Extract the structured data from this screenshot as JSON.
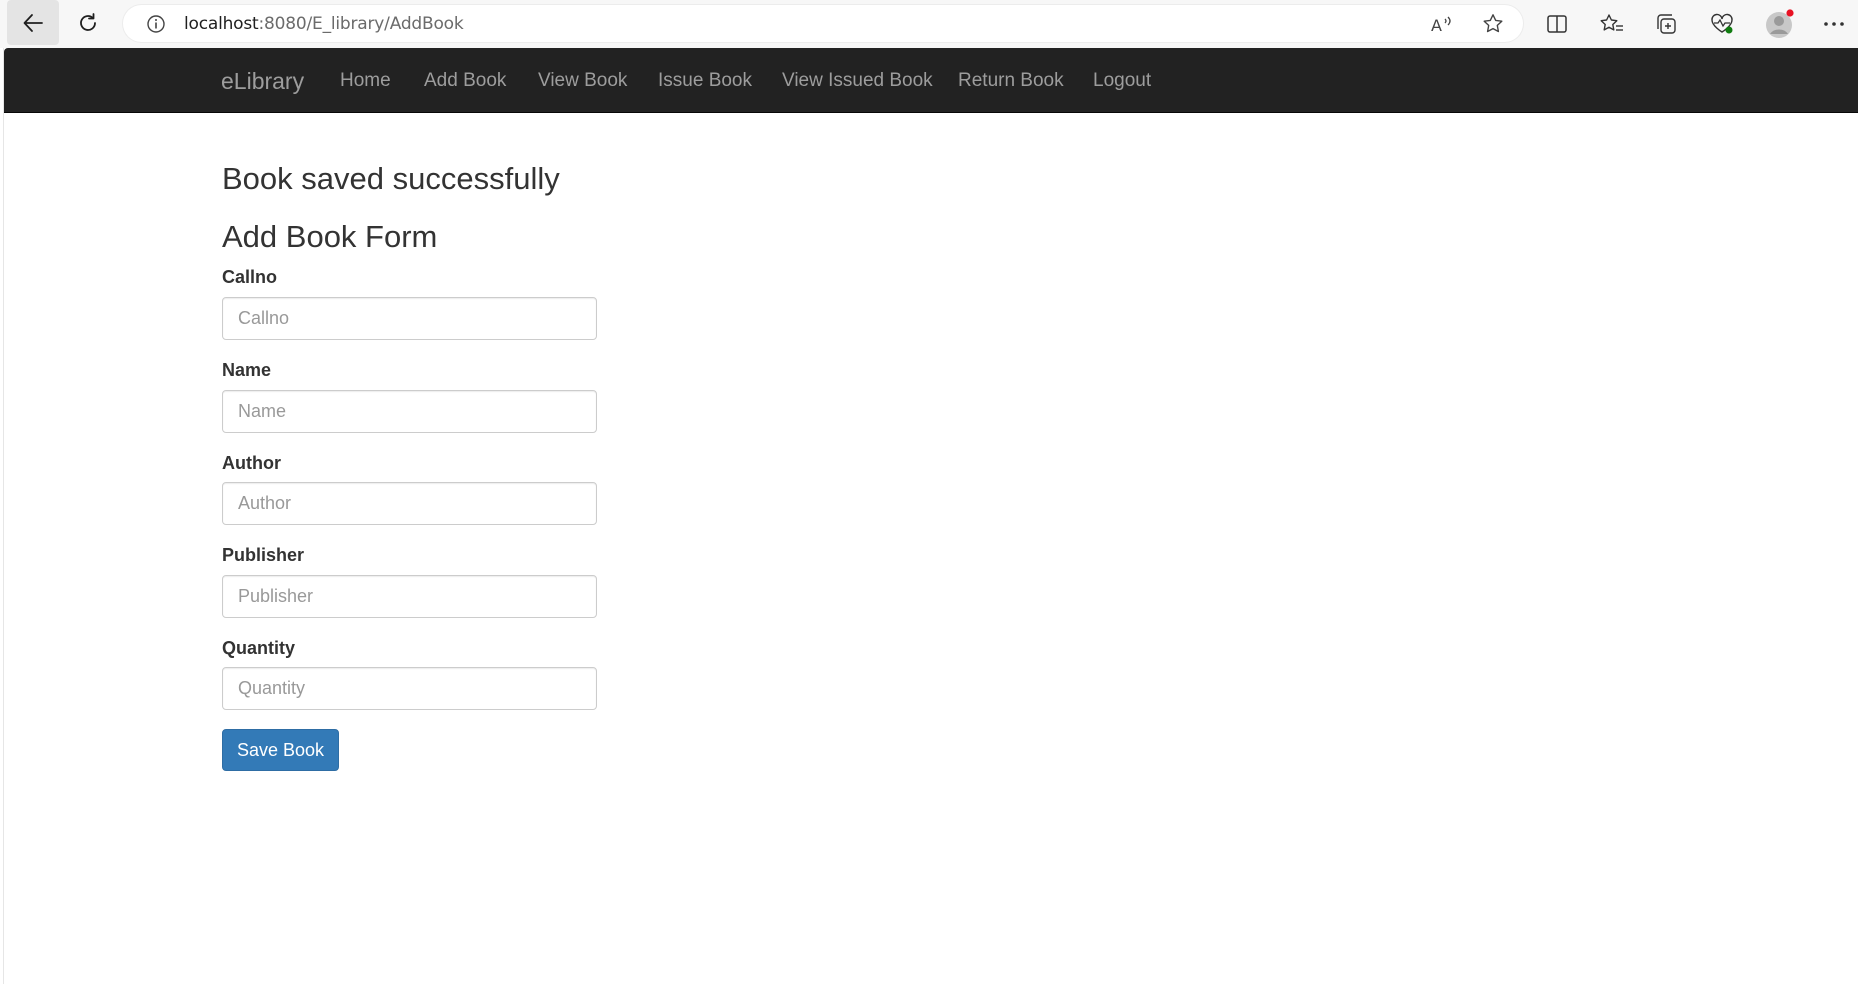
{
  "browser": {
    "url_host": "localhost",
    "url_rest": ":8080/E_library/AddBook",
    "icons": {
      "back": "back-arrow-icon",
      "reload": "reload-icon",
      "site_info": "info-icon",
      "read_aloud": "read-aloud-icon",
      "favorite": "star-icon",
      "split_screen": "split-screen-icon",
      "favorites": "favorites-icon",
      "collections": "collections-icon",
      "browser_essentials": "heart-pulse-icon",
      "profile": "profile-avatar-icon",
      "more": "more-icon"
    }
  },
  "navbar": {
    "brand": "eLibrary",
    "items": [
      {
        "label": "Home"
      },
      {
        "label": "Add Book"
      },
      {
        "label": "View Book"
      },
      {
        "label": "Issue Book"
      },
      {
        "label": "View Issued Book"
      },
      {
        "label": "Return Book"
      },
      {
        "label": "Logout"
      }
    ]
  },
  "main": {
    "message": "Book saved successfully",
    "form_title": "Add Book Form",
    "fields": [
      {
        "label": "Callno",
        "placeholder": "Callno",
        "value": ""
      },
      {
        "label": "Name",
        "placeholder": "Name",
        "value": ""
      },
      {
        "label": "Author",
        "placeholder": "Author",
        "value": ""
      },
      {
        "label": "Publisher",
        "placeholder": "Publisher",
        "value": ""
      },
      {
        "label": "Quantity",
        "placeholder": "Quantity",
        "value": ""
      }
    ],
    "save_button": "Save Book"
  },
  "colors": {
    "navbar_bg": "#222222",
    "nav_text": "#9d9d9d",
    "button_primary": "#337ab7",
    "profile_notification": "#e81123"
  }
}
